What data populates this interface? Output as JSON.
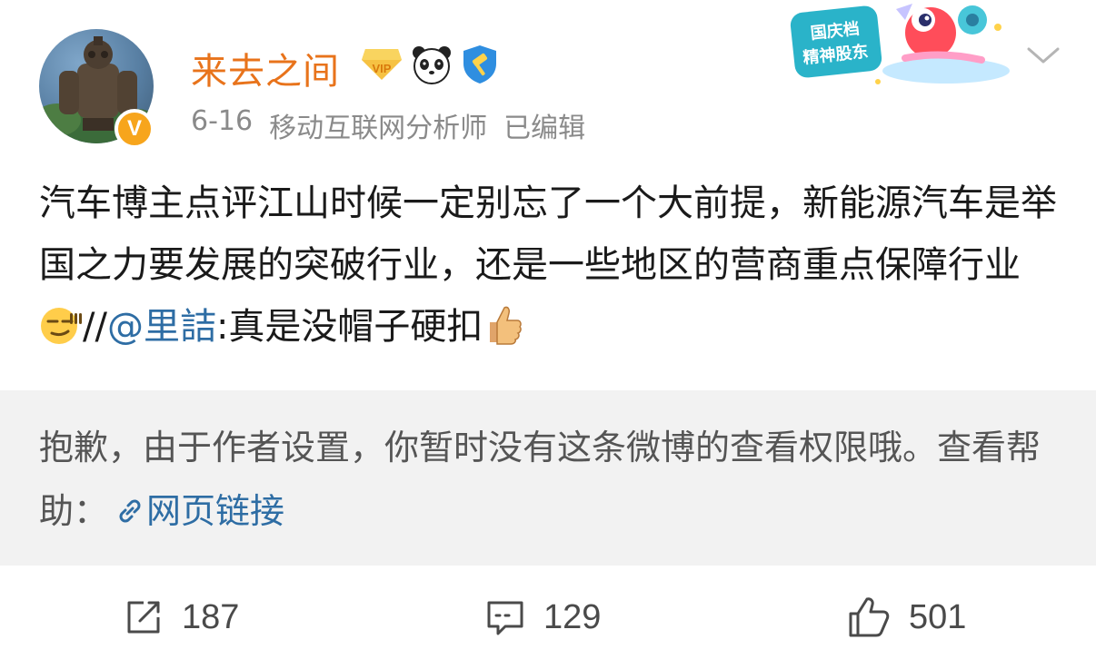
{
  "post": {
    "username": "来去之间",
    "date": "6-16",
    "title": "移动互联网分析师",
    "edited": "已编辑",
    "verified_badge": "V",
    "badges": [
      "vip-icon",
      "panda-icon",
      "gavel-shield-icon"
    ],
    "promo_text_1": "国庆档",
    "promo_text_2": "精神股东",
    "body_part1": "汽车博主点评江山时候一定别忘了一个大前提，新能源汽车是举国之力要发展的突破行业，还是一些地区的营商重点保障行业",
    "body_sep": "//",
    "body_mention": "@里詰",
    "body_part2": ":真是没帽子硬扣",
    "emoji_1": "smirk-emoji",
    "emoji_2": "thumbs-up-emoji"
  },
  "notice": {
    "message": "抱歉，由于作者设置，你暂时没有这条微博的查看权限哦。查看帮助：",
    "link_text": "网页链接"
  },
  "actions": {
    "repost_count": "187",
    "comment_count": "129",
    "like_count": "501"
  },
  "colors": {
    "username": "#e8731b",
    "link": "#2e6da4",
    "meta": "#8a8a8a",
    "notice_bg": "#f2f2f2",
    "badge_orange": "#f7a51c"
  }
}
